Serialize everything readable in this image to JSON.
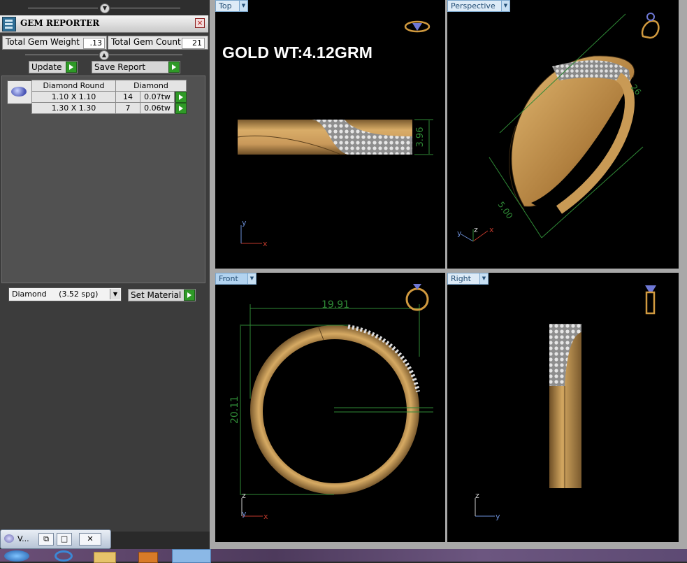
{
  "gem_reporter": {
    "title": "GEM REPORTER",
    "close_icon": "×",
    "total_gem_weight_label": "Total Gem Weight",
    "total_gem_weight_value": ".13",
    "total_gem_count_label": "Total Gem Count",
    "total_gem_count_value": "21",
    "update_label": "Update",
    "save_report_label": "Save Report",
    "table": {
      "headers": [
        "Diamond Round",
        "Diamond"
      ],
      "rows": [
        {
          "size": "1.10 X 1.10",
          "count": "14",
          "weight": "0.07tw"
        },
        {
          "size": "1.30 X 1.30",
          "count": "7",
          "weight": "0.06tw"
        }
      ]
    },
    "material_select_value": "Diamond     (3.52 spg)",
    "set_material_label": "Set Material"
  },
  "viewports": {
    "top": {
      "label": "Top",
      "gold_weight_text": "GOLD WT:4.12GRM",
      "dimension": "3.96",
      "axis_x": "x",
      "axis_y": "y"
    },
    "perspective": {
      "label": "Perspective",
      "dim_a": "26",
      "dim_b": "5.00",
      "axis_x": "x",
      "axis_y": "y",
      "axis_z": "z"
    },
    "front": {
      "label": "Front",
      "width_dim": "19.91",
      "height_dim": "20.11",
      "axis_x": "x",
      "axis_y": "y",
      "axis_z": "z"
    },
    "right": {
      "label": "Right",
      "axis_y": "y",
      "axis_z": "z"
    }
  },
  "taskbar": {
    "window_label": "V...",
    "restore_icon": "⧉",
    "maximize_icon": "□",
    "close_icon": "✕"
  },
  "colors": {
    "gold": "#c99a55",
    "dimension_green": "#2f8a36",
    "axis_red": "#c0392b",
    "axis_blue": "#6c8fd8",
    "accent_green_button": "#2f9a27"
  },
  "icons": [
    "gem-logo-icon",
    "ring-preview-icon",
    "play-icon",
    "dropdown-arrow-icon",
    "close-icon",
    "windows-start-icon",
    "ie-icon",
    "folder-icon",
    "media-icon",
    "app-icon"
  ]
}
